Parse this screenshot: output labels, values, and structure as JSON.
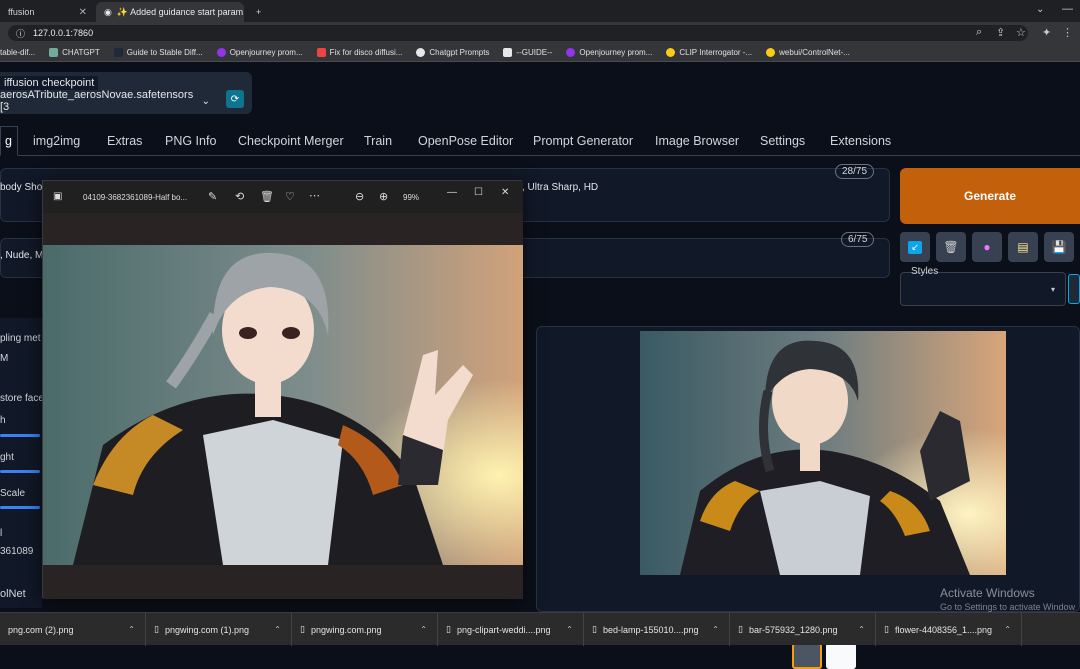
{
  "browser": {
    "tabs": [
      {
        "label": "ffusion",
        "active": false
      },
      {
        "label": "✨ Added guidance start param",
        "active": true
      }
    ],
    "new_tab": "+",
    "url": "127.0.0.1:7860",
    "bookmarks": [
      "table-dif...",
      "CHATGPT",
      "Guide to Stable Diff...",
      "Openjourney prom...",
      "Fix for disco diffusi...",
      "Chatgpt Prompts",
      "--GUIDE--",
      "Openjourney prom...",
      "CLIP Interrogator -...",
      "webui/ControlNet-..."
    ]
  },
  "checkpoint": {
    "label": "iffusion checkpoint",
    "value": "aerosATribute_aerosNovae.safetensors [3",
    "refresh_icon": "refresh-icon"
  },
  "main_tabs": [
    "g",
    "img2img",
    "Extras",
    "PNG Info",
    "Checkpoint Merger",
    "Train",
    "OpenPose Editor",
    "Prompt Generator",
    "Image Browser",
    "Settings",
    "Extensions"
  ],
  "prompt": {
    "positive_left": "body Sho",
    "positive_right": ", Ultra Sharp, HD",
    "positive_count": "28/75",
    "negative_left": ", Nude, M",
    "negative_count": "6/75"
  },
  "generate_label": "Generate",
  "styles_label": "Styles",
  "left_labels": [
    "pling met",
    "M",
    "store face",
    "h",
    "ght",
    "Scale",
    "l",
    "361089",
    "olNet"
  ],
  "viewer": {
    "filename": "04109-3682361089-Half bo...",
    "zoom": "99%"
  },
  "downloads": [
    "png.com (2).png",
    "pngwing.com (1).png",
    "pngwing.com.png",
    "png-clipart-weddi....png",
    "bed-lamp-155010....png",
    "bar-575932_1280.png",
    "flower-4408356_1....png"
  ],
  "watermark": {
    "title": "Activate Windows",
    "subtitle": "Go to Settings to activate Window"
  },
  "colors": {
    "generate": "#c2600b",
    "accent": "#3b82f6"
  }
}
